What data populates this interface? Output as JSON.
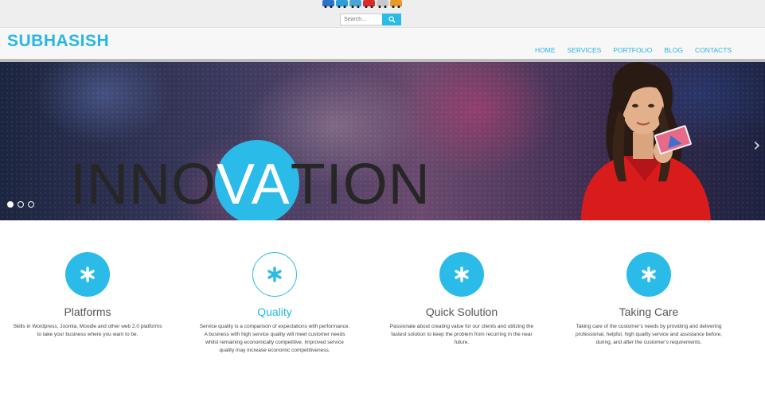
{
  "top": {
    "truck_icons": [
      "#2a73c9",
      "#2a9fd9",
      "#4aa6d6",
      "#d82d2d",
      "#c9c9c9",
      "#e89a2a"
    ],
    "search": {
      "placeholder": "Search..."
    }
  },
  "header": {
    "logo": "SUBHASISH",
    "nav": [
      "HOME",
      "SERVICES",
      "PORTFOLIO",
      "BLOG",
      "CONTACTS"
    ]
  },
  "slider": {
    "headline_left": "INNO",
    "headline_mid": "VA",
    "headline_right": "TION",
    "slide_count": 3,
    "active_slide": 1,
    "next_arrow": "chevron-right-icon"
  },
  "features": [
    {
      "title": "Platforms",
      "text": "Skills in Wordpress, Joomla, Moodle and other web 2.0 platforms to take your business where you want to be.",
      "icon": "asterisk-icon",
      "style": "filled"
    },
    {
      "title": "Quality",
      "text": "Service quality is a comparison of expectations with performance. A business with high service quality will meet customer needs whilst remaining economically competitive. Improved service quality may increase economic competitiveness.",
      "icon": "asterisk-icon",
      "style": "outline"
    },
    {
      "title": "Quick Solution",
      "text": "Passionate about creating value for our clients and utilizing the fastest solution to keep the problem from recurring in the near future.",
      "icon": "asterisk-icon",
      "style": "filled"
    },
    {
      "title": "Taking Care",
      "text": "Taking care of the customer's needs by providing and delivering professional, helpful, high quality service and assistance before, during, and after the customer's requirements.",
      "icon": "asterisk-icon",
      "style": "filled"
    }
  ],
  "colors": {
    "accent": "#2bbbe8",
    "header_bg": "#f7f7f7",
    "top_bg": "#eeeeee"
  }
}
